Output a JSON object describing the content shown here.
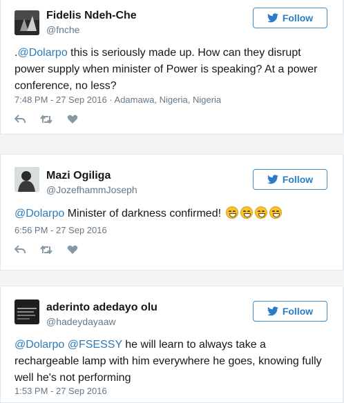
{
  "colors": {
    "link": "#2b7bb9",
    "follow": "#2a7cc9",
    "muted": "#657786"
  },
  "tweets": [
    {
      "name": "Fidelis Ndeh-Che",
      "handle": "@fnche",
      "follow_label": "Follow",
      "text_prefix": ".",
      "mention1": "@Dolarpo",
      "text_body": " this is seriously made up. How can they disrupt power supply when minister of Power is speaking? At a power conference, no less?",
      "meta": "7:48 PM - 27 Sep 2016 · Adamawa, Nigeria, Nigeria"
    },
    {
      "name": "Mazi Ogiliga",
      "handle": "@JozefhammJoseph",
      "follow_label": "Follow",
      "mention1": "@Dolarpo",
      "text_body": " Minister of darkness confirmed! ",
      "emoji_count": 4,
      "emoji_name": "grinning-face",
      "meta": "6:56 PM - 27 Sep 2016"
    },
    {
      "name": "aderinto adedayo olu",
      "handle": "@hadeydayaaw",
      "follow_label": "Follow",
      "mention1": "@Dolarpo",
      "mention2": "@FSESSY",
      "text_body": " he will learn to always take a rechargeable lamp with him everywhere he goes, knowing fully well he's not performing",
      "meta": "1:53 PM - 27 Sep 2016"
    }
  ]
}
